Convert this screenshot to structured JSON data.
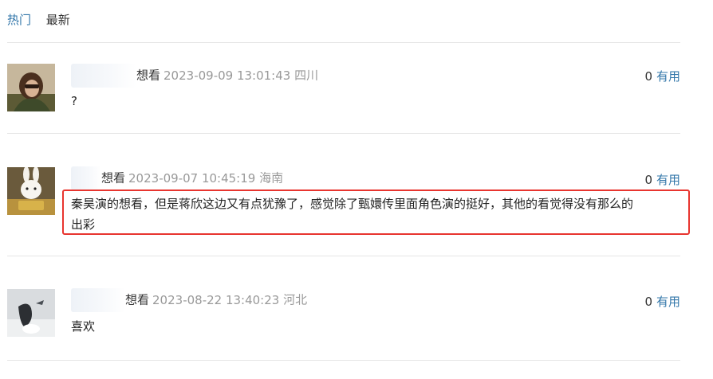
{
  "tabs": {
    "hot": "热门",
    "latest": "最新"
  },
  "comments": [
    {
      "status": "想看",
      "time": "2023-09-09 13:01:43",
      "location": "四川",
      "votes": "0",
      "useful_label": "有用",
      "text": "?"
    },
    {
      "status": "想看",
      "time": "2023-09-07 10:45:19",
      "location": "海南",
      "votes": "0",
      "useful_label": "有用",
      "text_line1": "秦昊演的想看，但是蒋欣这边又有点犹豫了，感觉除了甄嬛传里面角色演的挺好，其他的看觉得没有那么的",
      "text_line2": "出彩"
    },
    {
      "status": "想看",
      "time": "2023-08-22 13:40:23",
      "location": "河北",
      "votes": "0",
      "useful_label": "有用",
      "text": "喜欢"
    }
  ],
  "colors": {
    "link": "#3377aa",
    "highlight_border": "#e8352f",
    "meta": "#999999"
  }
}
